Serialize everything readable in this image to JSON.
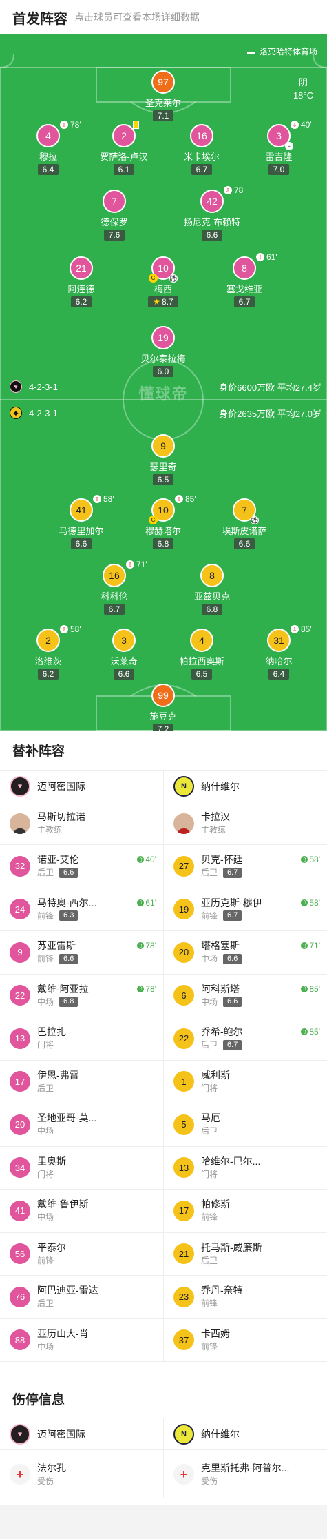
{
  "header": {
    "title": "首发阵容",
    "subtitle": "点击球员可查看本场详细数据"
  },
  "pitch": {
    "stadium": "洛克哈特体育场",
    "weather": "阴",
    "temperature": "18°C",
    "watermark": "懂球帝",
    "home": {
      "formation": "4-2-3-1",
      "info": "身价6600万欧 平均27.4岁"
    },
    "away": {
      "formation": "4-2-3-1",
      "info": "身价2635万欧 平均27.0岁"
    }
  },
  "home_players": [
    {
      "num": "97",
      "name": "圣克莱尔",
      "rating": "7.1"
    },
    {
      "num": "4",
      "name": "穆拉",
      "rating": "6.4",
      "sub": "78'"
    },
    {
      "num": "2",
      "name": "贾萨洛-卢汉",
      "rating": "6.1"
    },
    {
      "num": "16",
      "name": "米卡埃尔",
      "rating": "6.7"
    },
    {
      "num": "3",
      "name": "雷吉隆",
      "rating": "7.0",
      "sub": "40'"
    },
    {
      "num": "7",
      "name": "德保罗",
      "rating": "7.6"
    },
    {
      "num": "42",
      "name": "扬尼克-布赖特",
      "rating": "6.6",
      "sub": "78'"
    },
    {
      "num": "21",
      "name": "阿连德",
      "rating": "6.2"
    },
    {
      "num": "10",
      "name": "梅西",
      "rating": "8.7"
    },
    {
      "num": "8",
      "name": "塞戈维亚",
      "rating": "6.7",
      "sub": "61'"
    },
    {
      "num": "19",
      "name": "贝尔泰拉梅",
      "rating": "6.0"
    }
  ],
  "away_players": [
    {
      "num": "9",
      "name": "瑟里奇",
      "rating": "6.5"
    },
    {
      "num": "41",
      "name": "马德里加尔",
      "rating": "6.6",
      "sub": "58'"
    },
    {
      "num": "10",
      "name": "穆赫塔尔",
      "rating": "6.8",
      "sub": "85'"
    },
    {
      "num": "7",
      "name": "埃斯皮诺萨",
      "rating": "6.6"
    },
    {
      "num": "16",
      "name": "科科伦",
      "rating": "6.7",
      "sub": "71'"
    },
    {
      "num": "8",
      "name": "亚兹贝克",
      "rating": "6.8"
    },
    {
      "num": "2",
      "name": "洛维茨",
      "rating": "6.2",
      "sub": "58'"
    },
    {
      "num": "3",
      "name": "沃莱奇",
      "rating": "6.6"
    },
    {
      "num": "4",
      "name": "帕拉西奥斯",
      "rating": "6.5"
    },
    {
      "num": "31",
      "name": "纳哈尔",
      "rating": "6.4",
      "sub": "85'"
    },
    {
      "num": "99",
      "name": "施豆克",
      "rating": "7.2"
    }
  ],
  "subs": {
    "title": "替补阵容",
    "home_team": "迈阿密国际",
    "away_team": "纳什维尔",
    "home_coach": {
      "name": "马斯切拉诺",
      "role": "主教练"
    },
    "away_coach": {
      "name": "卡拉汉",
      "role": "主教练"
    },
    "home": [
      {
        "num": "32",
        "name": "诺亚-艾伦",
        "pos": "后卫",
        "rating": "6.6",
        "time": "40'"
      },
      {
        "num": "24",
        "name": "马特奥-西尔...",
        "pos": "前锋",
        "rating": "6.3",
        "time": "61'"
      },
      {
        "num": "9",
        "name": "苏亚雷斯",
        "pos": "前锋",
        "rating": "6.6",
        "time": "78'"
      },
      {
        "num": "22",
        "name": "戴维-阿亚拉",
        "pos": "中场",
        "rating": "6.8",
        "time": "78'"
      },
      {
        "num": "13",
        "name": "巴拉扎",
        "pos": "门将"
      },
      {
        "num": "17",
        "name": "伊恩-弗雷",
        "pos": "后卫"
      },
      {
        "num": "20",
        "name": "圣地亚哥-莫...",
        "pos": "中场"
      },
      {
        "num": "34",
        "name": "里奥斯",
        "pos": "门将"
      },
      {
        "num": "41",
        "name": "戴维-鲁伊斯",
        "pos": "中场"
      },
      {
        "num": "56",
        "name": "平泰尔",
        "pos": "前锋"
      },
      {
        "num": "76",
        "name": "阿巴迪亚-雷达",
        "pos": "后卫"
      },
      {
        "num": "88",
        "name": "亚历山大-肖",
        "pos": "中场"
      }
    ],
    "away": [
      {
        "num": "27",
        "name": "贝克-怀廷",
        "pos": "后卫",
        "rating": "6.7",
        "time": "58'"
      },
      {
        "num": "19",
        "name": "亚历克斯-穆伊",
        "pos": "前锋",
        "rating": "6.7",
        "time": "58'"
      },
      {
        "num": "20",
        "name": "塔格塞斯",
        "pos": "中场",
        "rating": "6.6",
        "time": "71'"
      },
      {
        "num": "6",
        "name": "阿科斯塔",
        "pos": "中场",
        "rating": "6.6",
        "time": "85'"
      },
      {
        "num": "22",
        "name": "乔希-鲍尔",
        "pos": "后卫",
        "rating": "6.7",
        "time": "85'"
      },
      {
        "num": "1",
        "name": "威利斯",
        "pos": "门将"
      },
      {
        "num": "5",
        "name": "马厄",
        "pos": "后卫"
      },
      {
        "num": "13",
        "name": "哈维尔-巴尔...",
        "pos": "门将"
      },
      {
        "num": "17",
        "name": "帕修斯",
        "pos": "前锋"
      },
      {
        "num": "21",
        "name": "托马斯-威廉斯",
        "pos": "后卫"
      },
      {
        "num": "23",
        "name": "乔丹-奈特",
        "pos": "前锋"
      },
      {
        "num": "37",
        "name": "卡西姆",
        "pos": "前锋"
      }
    ]
  },
  "injuries": {
    "title": "伤停信息",
    "home_team": "迈阿密国际",
    "away_team": "纳什维尔",
    "home": {
      "name": "法尔孔",
      "status": "受伤"
    },
    "away": {
      "name": "克里斯托弗-阿普尔...",
      "status": "受伤"
    }
  },
  "colors": {
    "pitch": "#2fb04d",
    "home": "#e0559b",
    "away": "#f5c21a",
    "keeper_home": "#f06d1a"
  }
}
